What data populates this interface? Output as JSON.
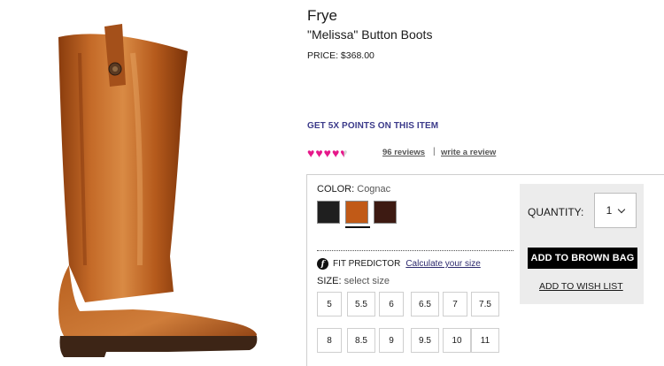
{
  "product": {
    "brand": "Frye",
    "name": "\"Melissa\" Button Boots",
    "price": "PRICE: $368.00",
    "points_promo": "GET 5X POINTS ON THIS ITEM"
  },
  "rating": {
    "hearts_filled": 4.5,
    "hearts_total": 5,
    "reviews_link": "96 reviews",
    "separator": "|",
    "write_review_link": "write a review",
    "heart_color": "#e6178a"
  },
  "color": {
    "label": "COLOR:",
    "selected": "Cognac",
    "swatches": [
      {
        "name": "black",
        "color": "#1f1f1f"
      },
      {
        "name": "cognac",
        "color": "#c15a17"
      },
      {
        "name": "dark-brown",
        "color": "#3d1a12"
      }
    ]
  },
  "fit": {
    "icon_glyph": "f",
    "label": "FIT PREDICTOR",
    "link": "Calculate your size"
  },
  "size": {
    "label": "SIZE:",
    "prompt": "select size",
    "options": [
      "5",
      "5.5",
      "6",
      "6.5",
      "7",
      "7.5",
      "8",
      "8.5",
      "9",
      "9.5",
      "10",
      "11"
    ]
  },
  "cart": {
    "quantity_label": "QUANTITY:",
    "quantity_value": "1",
    "add_button": "ADD TO BROWN BAG",
    "wish_link": "ADD TO WISH LIST"
  }
}
